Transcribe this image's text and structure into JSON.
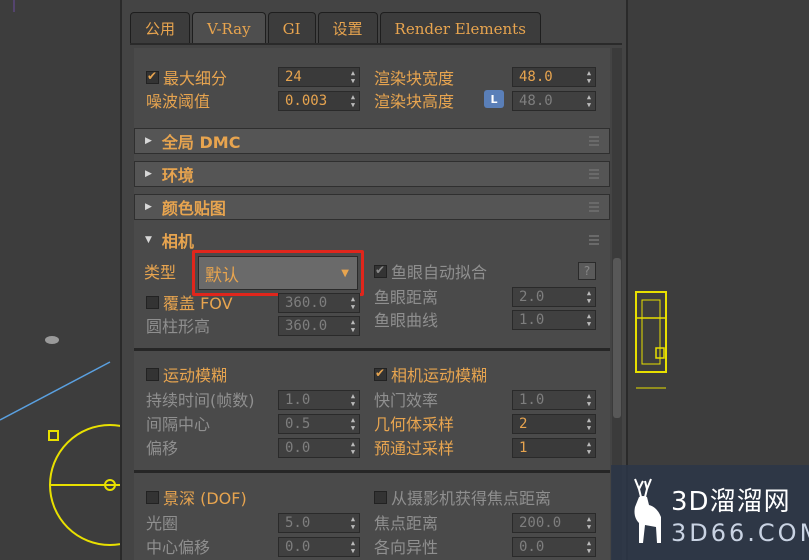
{
  "tabs": [
    {
      "label": "公用"
    },
    {
      "label": "V-Ray"
    },
    {
      "label": "GI"
    },
    {
      "label": "设置"
    },
    {
      "label": "Render Elements"
    }
  ],
  "image_sampler": {
    "max_subdivs_label": "最大细分",
    "max_subdivs_value": "24",
    "noise_threshold_label": "噪波阈值",
    "noise_threshold_value": "0.003",
    "bucket_width_label": "渲染块宽度",
    "bucket_width_value": "48.0",
    "bucket_height_label": "渲染块高度",
    "bucket_height_value": "48.0",
    "lock_label": "L"
  },
  "rollouts": {
    "global_dmc": "全局 DMC",
    "environment": "环境",
    "color_mapping": "颜色贴图",
    "camera": "相机"
  },
  "camera": {
    "type_label": "类型",
    "type_value": "默认",
    "fisheye_autofit_label": "鱼眼自动拟合",
    "help_label": "?",
    "override_fov_label": "覆盖 FOV",
    "override_fov_value": "360.0",
    "cylinder_height_label": "圆柱形高",
    "cylinder_height_value": "360.0",
    "fisheye_dist_label": "鱼眼距离",
    "fisheye_dist_value": "2.0",
    "fisheye_curve_label": "鱼眼曲线",
    "fisheye_curve_value": "1.0"
  },
  "motion_blur": {
    "motion_blur_label": "运动模糊",
    "camera_motion_blur_label": "相机运动模糊",
    "duration_label": "持续时间(帧数)",
    "duration_value": "1.0",
    "interval_center_label": "间隔中心",
    "interval_center_value": "0.5",
    "bias_label": "偏移",
    "bias_value": "0.0",
    "shutter_eff_label": "快门效率",
    "shutter_eff_value": "1.0",
    "geometry_samples_label": "几何体采样",
    "geometry_samples_value": "2",
    "prepass_samples_label": "预通过采样",
    "prepass_samples_value": "1"
  },
  "dof": {
    "dof_label": "景深 (DOF)",
    "from_camera_label": "从摄影机获得焦点距离",
    "aperture_label": "光圈",
    "aperture_value": "5.0",
    "center_bias_label": "中心偏移",
    "center_bias_value": "0.0",
    "focal_dist_label": "焦点距离",
    "focal_dist_value": "200.0",
    "anisotropy_label": "各向异性",
    "anisotropy_value": "0.0"
  },
  "watermark": {
    "line1": "3D溜溜网",
    "line2": "3D66.COM"
  },
  "colors": {
    "accent": "#e7a44f",
    "highlight_box": "#e0261c",
    "viewport_lines": "#e8e000"
  }
}
